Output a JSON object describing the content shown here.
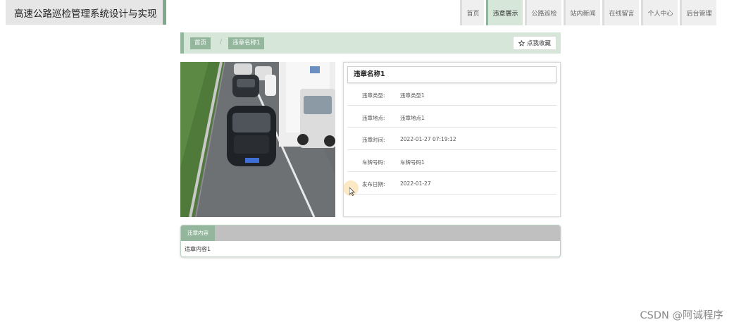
{
  "site": {
    "title": "高速公路巡检管理系统设计与实现"
  },
  "nav": {
    "items": [
      {
        "label": "首页",
        "active": false
      },
      {
        "label": "违章展示",
        "active": true
      },
      {
        "label": "公路巡检",
        "active": false
      },
      {
        "label": "站内新闻",
        "active": false
      },
      {
        "label": "在线留言",
        "active": false
      },
      {
        "label": "个人中心",
        "active": false
      },
      {
        "label": "后台管理",
        "active": false
      }
    ]
  },
  "breadcrumb": {
    "home": "首页",
    "separator": "/",
    "current": "违章名称1"
  },
  "favorite": {
    "label": "点我收藏",
    "icon": "star-icon"
  },
  "detail": {
    "title": "违章名称1",
    "fields": [
      {
        "label": "违章类型:",
        "value": "违章类型1"
      },
      {
        "label": "违章地点:",
        "value": "违章地点1"
      },
      {
        "label": "违章时间:",
        "value": "2022-01-27 07:19:12"
      },
      {
        "label": "车牌号码:",
        "value": "车牌号码1"
      },
      {
        "label": "发布日期:",
        "value": "2022-01-27"
      }
    ]
  },
  "content": {
    "tab_label": "违章内容",
    "text": "违章内容1"
  },
  "watermark": "CSDN @阿诚程序",
  "colors": {
    "accent": "#93b69d",
    "accent_light": "#d6e6d8"
  }
}
